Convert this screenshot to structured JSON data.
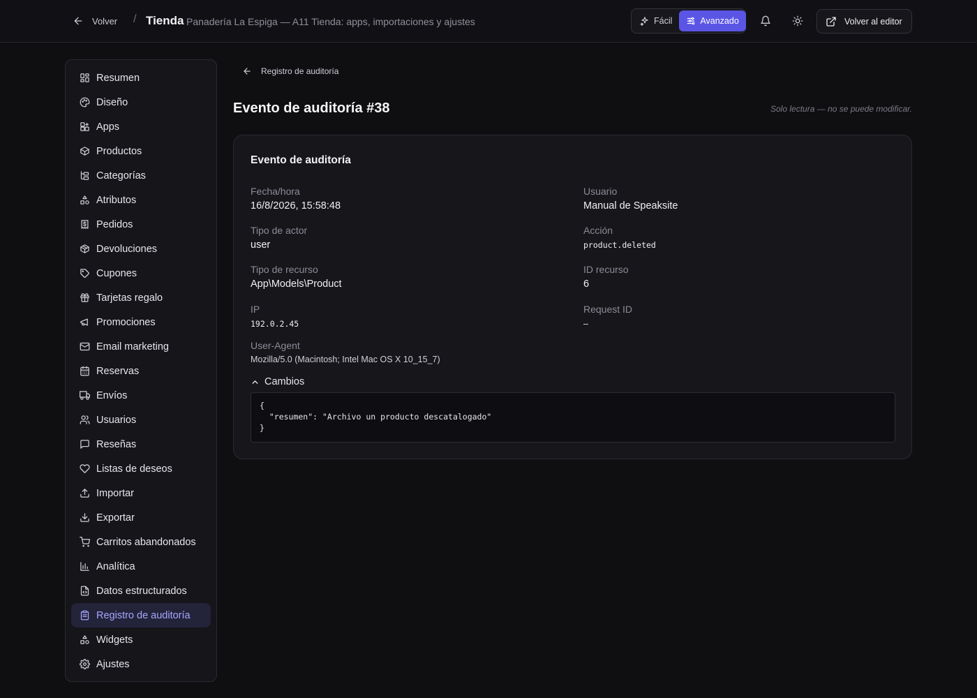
{
  "header": {
    "back_label": "Volver",
    "separator": "/",
    "title": "Tienda",
    "subtitle": "Panadería La Espiga — A11 Tienda: apps, importaciones y ajustes",
    "mode_easy": "Fácil",
    "mode_advanced": "Avanzado",
    "mode_active": "Avanzado",
    "editor_button": "Volver al editor",
    "accent_color": "#5b55e6"
  },
  "sidebar": {
    "active_item": "Registro de auditoría",
    "items": [
      {
        "label": "Resumen",
        "icon": "dashboard-icon"
      },
      {
        "label": "Diseño",
        "icon": "palette-icon"
      },
      {
        "label": "Apps",
        "icon": "apps-icon"
      },
      {
        "label": "Productos",
        "icon": "box-icon"
      },
      {
        "label": "Categorías",
        "icon": "tree-icon"
      },
      {
        "label": "Atributos",
        "icon": "shapes-icon"
      },
      {
        "label": "Pedidos",
        "icon": "receipt-icon"
      },
      {
        "label": "Devoluciones",
        "icon": "package-return-icon"
      },
      {
        "label": "Cupones",
        "icon": "tag-icon"
      },
      {
        "label": "Tarjetas regalo",
        "icon": "gift-icon"
      },
      {
        "label": "Promociones",
        "icon": "megaphone-icon"
      },
      {
        "label": "Email marketing",
        "icon": "mail-icon"
      },
      {
        "label": "Reservas",
        "icon": "calendar-icon"
      },
      {
        "label": "Envíos",
        "icon": "truck-icon"
      },
      {
        "label": "Usuarios",
        "icon": "users-icon"
      },
      {
        "label": "Reseñas",
        "icon": "message-icon"
      },
      {
        "label": "Listas de deseos",
        "icon": "heart-icon"
      },
      {
        "label": "Importar",
        "icon": "upload-icon"
      },
      {
        "label": "Exportar",
        "icon": "download-icon"
      },
      {
        "label": "Carritos abandonados",
        "icon": "cart-icon"
      },
      {
        "label": "Analítica",
        "icon": "bar-chart-icon"
      },
      {
        "label": "Datos estructurados",
        "icon": "file-code-icon"
      },
      {
        "label": "Registro de auditoría",
        "icon": "clipboard-icon"
      },
      {
        "label": "Widgets",
        "icon": "shapes-icon"
      },
      {
        "label": "Ajustes",
        "icon": "gear-icon"
      }
    ]
  },
  "main": {
    "back_label": "Registro de auditoría",
    "title": "Evento de auditoría #38",
    "readonly_note": "Solo lectura — no se puede modificar.",
    "card_title": "Evento de auditoría",
    "fields": {
      "datetime": {
        "label": "Fecha/hora",
        "value": "16/8/2026, 15:58:48"
      },
      "user": {
        "label": "Usuario",
        "value": "Manual de Speaksite"
      },
      "actor_type": {
        "label": "Tipo de actor",
        "value": "user"
      },
      "action": {
        "label": "Acción",
        "value": "product.deleted"
      },
      "resource_type": {
        "label": "Tipo de recurso",
        "value": "App\\Models\\Product"
      },
      "resource_id": {
        "label": "ID recurso",
        "value": "6"
      },
      "ip": {
        "label": "IP",
        "value": "192.0.2.45"
      },
      "request_id": {
        "label": "Request ID",
        "value": "—"
      },
      "user_agent": {
        "label": "User-Agent",
        "value": "Mozilla/5.0 (Macintosh; Intel Mac OS X 10_15_7)"
      }
    },
    "changes_label": "Cambios",
    "changes_json": "{\n  \"resumen\": \"Archivo un producto descatalogado\"\n}"
  }
}
